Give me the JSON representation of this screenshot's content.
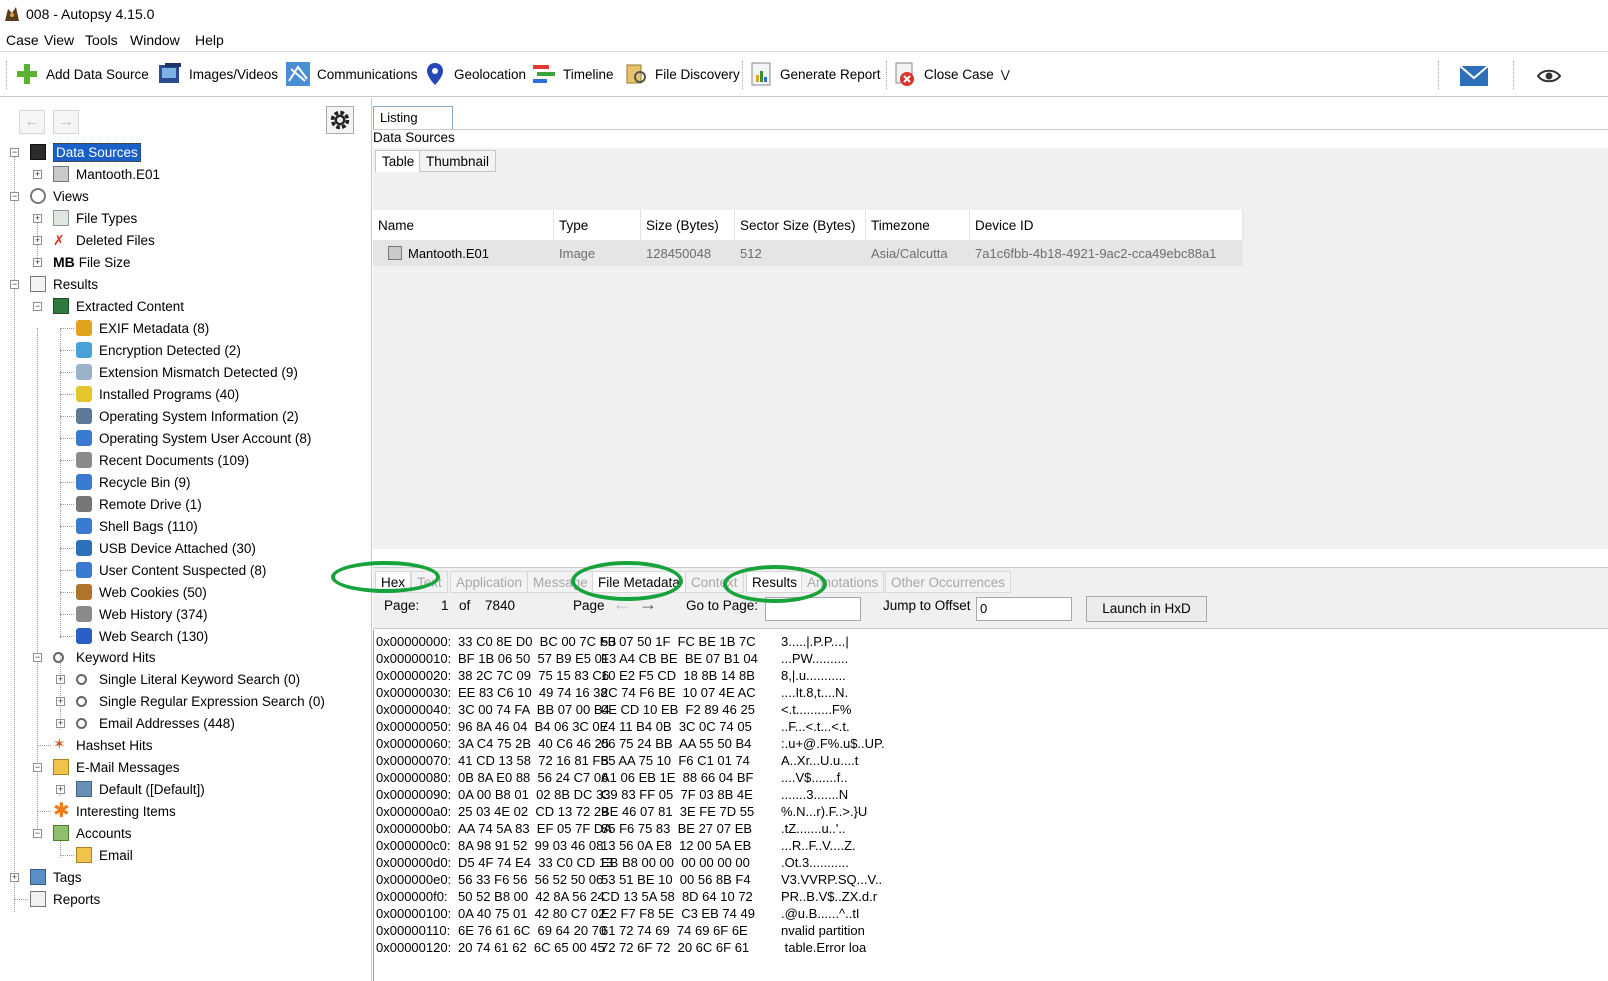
{
  "window": {
    "title": "008 - Autopsy 4.15.0"
  },
  "menu": [
    "Case",
    "View",
    "Tools",
    "Window",
    "Help"
  ],
  "toolbar": {
    "add_data_source": "Add Data Source",
    "images_videos": "Images/Videos",
    "communications": "Communications",
    "geolocation": "Geolocation",
    "timeline": "Timeline",
    "file_discovery": "File Discovery",
    "generate_report": "Generate Report",
    "close_case": "Close Case"
  },
  "tree": {
    "data_sources": "Data Sources",
    "mantooth": "Mantooth.E01",
    "views": "Views",
    "file_types": "File Types",
    "deleted_files": "Deleted Files",
    "mb": "MB",
    "file_size": "File Size",
    "results": "Results",
    "extracted_content": "Extracted Content",
    "extracted_items": [
      "EXIF Metadata (8)",
      "Encryption Detected (2)",
      "Extension Mismatch Detected (9)",
      "Installed Programs (40)",
      "Operating System Information (2)",
      "Operating System User Account (8)",
      "Recent Documents (109)",
      "Recycle Bin (9)",
      "Remote Drive (1)",
      "Shell Bags (110)",
      "USB Device Attached (30)",
      "User Content Suspected (8)",
      "Web Cookies (50)",
      "Web History (374)",
      "Web Search (130)"
    ],
    "keyword_hits": "Keyword Hits",
    "keyword_items": [
      "Single Literal Keyword Search (0)",
      "Single Regular Expression Search (0)",
      "Email Addresses (448)"
    ],
    "hashset_hits": "Hashset Hits",
    "email_messages": "E-Mail Messages",
    "default": "Default ([Default])",
    "interesting_items": "Interesting Items",
    "accounts": "Accounts",
    "email": "Email",
    "tags": "Tags",
    "reports": "Reports"
  },
  "listing": {
    "tab": "Listing",
    "heading": "Data Sources",
    "tabs": [
      "Table",
      "Thumbnail"
    ],
    "columns": [
      "Name",
      "Type",
      "Size (Bytes)",
      "Sector Size (Bytes)",
      "Timezone",
      "Device ID"
    ],
    "row": [
      "Mantooth.E01",
      "Image",
      "128450048",
      "512",
      "Asia/Calcutta",
      "7a1c6fbb-4b18-4921-9ac2-cca49ebc88a1"
    ]
  },
  "viewer": {
    "tabs": [
      "Hex",
      "Text",
      "Application",
      "Message",
      "File Metadata",
      "Context",
      "Results",
      "Annotations",
      "Other Occurrences"
    ],
    "page_label": "Page:",
    "page_num": "1",
    "of": "of",
    "page_total": "7840",
    "page_nav_label": "Page",
    "go_to_page": "Go to Page:",
    "jump_to_offset": "Jump to Offset",
    "offset_value": "0",
    "launch": "Launch in HxD"
  },
  "hex": [
    {
      "off": "0x00000000:",
      "a": "33 C0 8E D0  BC 00 7C FB",
      "b": "50 07 50 1F  FC BE 1B 7C",
      "t": "3.....|.P.P....|"
    },
    {
      "off": "0x00000010:",
      "a": "BF 1B 06 50  57 B9 E5 01",
      "b": "F3 A4 CB BE  BE 07 B1 04",
      "t": "...PW.........."
    },
    {
      "off": "0x00000020:",
      "a": "38 2C 7C 09  75 15 83 C6",
      "b": "10 E2 F5 CD  18 8B 14 8B",
      "t": "8,|.u..........."
    },
    {
      "off": "0x00000030:",
      "a": "EE 83 C6 10  49 74 16 38",
      "b": "2C 74 F6 BE  10 07 4E AC",
      "t": "....It.8,t....N."
    },
    {
      "off": "0x00000040:",
      "a": "3C 00 74 FA  BB 07 00 B4",
      "b": "0E CD 10 EB  F2 89 46 25",
      "t": "<.t..........F%"
    },
    {
      "off": "0x00000050:",
      "a": "96 8A 46 04  B4 06 3C 0E",
      "b": "74 11 B4 0B  3C 0C 74 05",
      "t": "..F...<.t...<.t."
    },
    {
      "off": "0x00000060:",
      "a": "3A C4 75 2B  40 C6 46 25",
      "b": "06 75 24 BB  AA 55 50 B4",
      "t": ":.u+@.F%.u$..UP."
    },
    {
      "off": "0x00000070:",
      "a": "41 CD 13 58  72 16 81 FB",
      "b": "55 AA 75 10  F6 C1 01 74",
      "t": "A..Xr...U.u....t"
    },
    {
      "off": "0x00000080:",
      "a": "0B 8A E0 88  56 24 C7 06",
      "b": "A1 06 EB 1E  88 66 04 BF",
      "t": "....V$.......f.."
    },
    {
      "off": "0x00000090:",
      "a": "0A 00 B8 01  02 8B DC 33",
      "b": "C9 83 FF 05  7F 03 8B 4E",
      "t": ".......3.......N"
    },
    {
      "off": "0x000000a0:",
      "a": "25 03 4E 02  CD 13 72 29",
      "b": "BE 46 07 81  3E FE 7D 55",
      "t": "%.N...r).F..>.}U"
    },
    {
      "off": "0x000000b0:",
      "a": "AA 74 5A 83  EF 05 7F DA",
      "b": "85 F6 75 83  BE 27 07 EB",
      "t": ".tZ.......u..'.."
    },
    {
      "off": "0x000000c0:",
      "a": "8A 98 91 52  99 03 46 08",
      "b": "13 56 0A E8  12 00 5A EB",
      "t": "...R..F..V....Z."
    },
    {
      "off": "0x000000d0:",
      "a": "D5 4F 74 E4  33 C0 CD 13",
      "b": "EB B8 00 00  00 00 00 00",
      "t": ".Ot.3..........."
    },
    {
      "off": "0x000000e0:",
      "a": "56 33 F6 56  56 52 50 06",
      "b": "53 51 BE 10  00 56 8B F4",
      "t": "V3.VVRP.SQ...V.."
    },
    {
      "off": "0x000000f0:",
      "a": "50 52 B8 00  42 8A 56 24",
      "b": "CD 13 5A 58  8D 64 10 72",
      "t": "PR..B.V$..ZX.d.r"
    },
    {
      "off": "0x00000100:",
      "a": "0A 40 75 01  42 80 C7 02",
      "b": "E2 F7 F8 5E  C3 EB 74 49",
      "t": ".@u.B......^..tI"
    },
    {
      "off": "0x00000110:",
      "a": "6E 76 61 6C  69 64 20 70",
      "b": "61 72 74 69  74 69 6F 6E",
      "t": "nvalid partition"
    },
    {
      "off": "0x00000120:",
      "a": "20 74 61 62  6C 65 00 45",
      "b": "72 72 6F 72  20 6C 6F 61",
      "t": " table.Error loa"
    }
  ],
  "colors": {
    "selection": "#1b5fc8",
    "annotation_ring": "#17a33b",
    "grid_row": "#e5e5e5"
  }
}
